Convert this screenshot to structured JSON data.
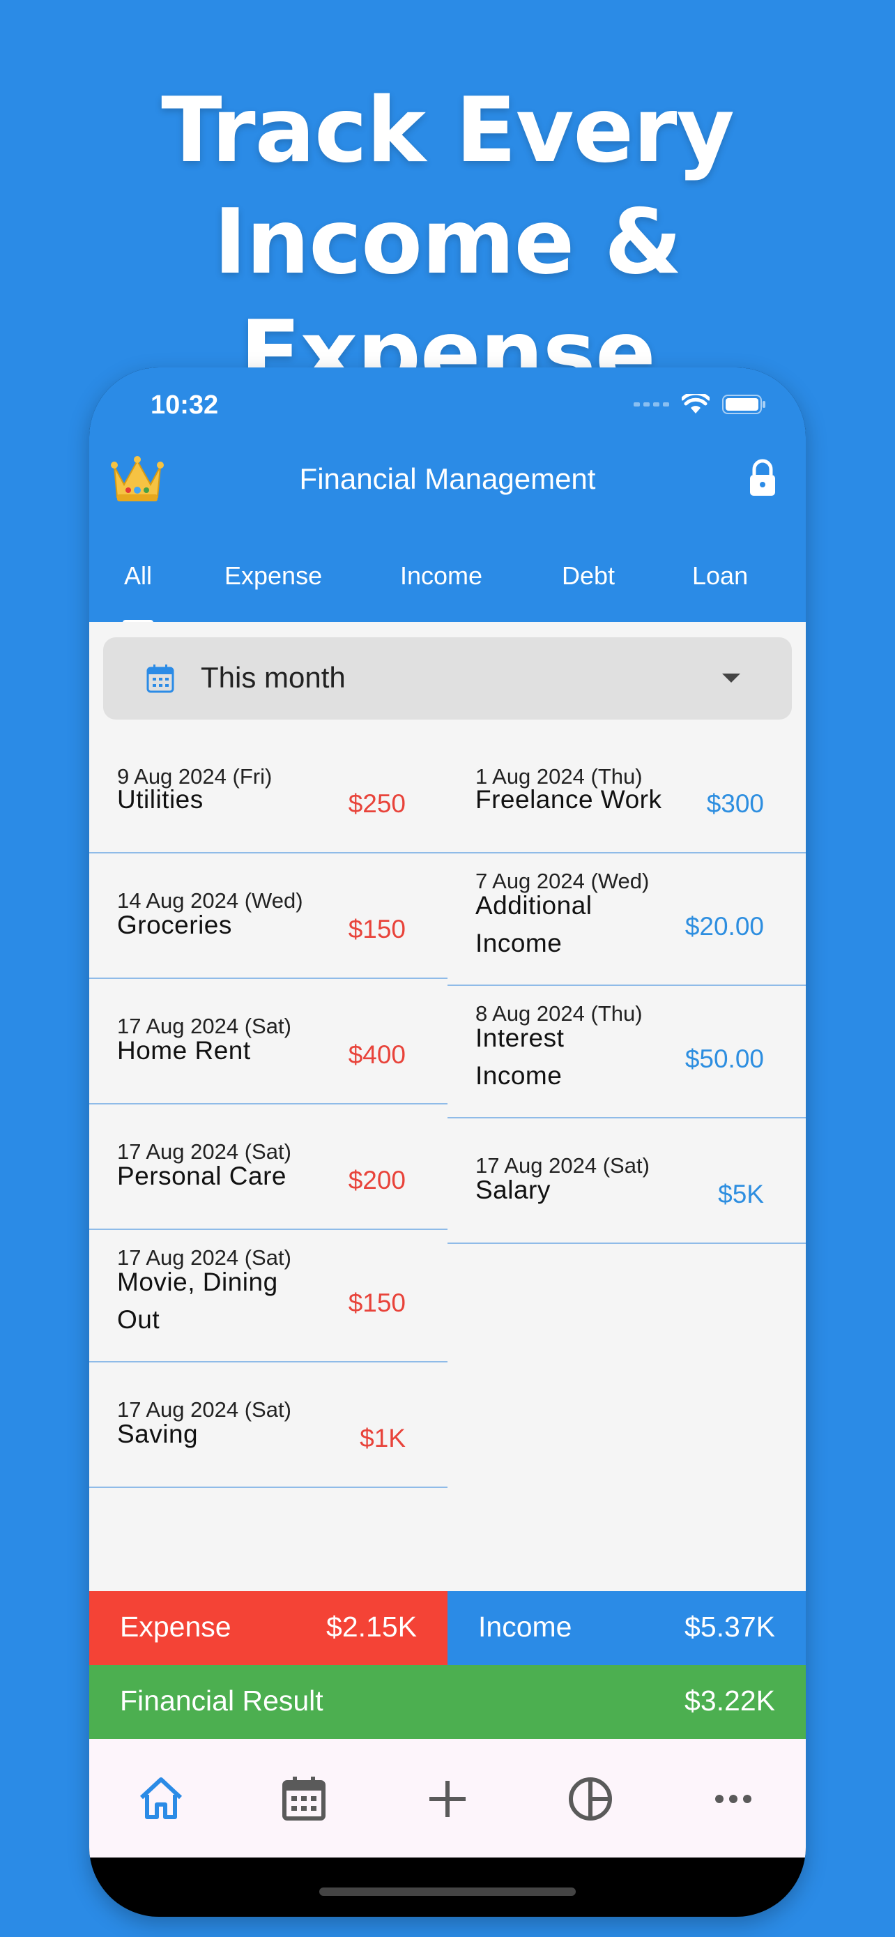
{
  "headline": {
    "line1": "Track Every",
    "line2": "Income & Expense"
  },
  "status_bar": {
    "time": "10:32"
  },
  "header": {
    "title": "Financial Management"
  },
  "tabs": [
    {
      "label": "All",
      "active": true
    },
    {
      "label": "Expense"
    },
    {
      "label": "Income"
    },
    {
      "label": "Debt"
    },
    {
      "label": "Loan"
    }
  ],
  "period_selector": {
    "label": "This month"
  },
  "expenses": [
    {
      "date": "9 Aug 2024 (Fri)",
      "name": "Utilities",
      "amount": "$250"
    },
    {
      "date": "14 Aug 2024 (Wed)",
      "name": "Groceries",
      "amount": "$150"
    },
    {
      "date": "17 Aug 2024 (Sat)",
      "name": "Home Rent",
      "amount": "$400"
    },
    {
      "date": "17 Aug 2024 (Sat)",
      "name": "Personal Care",
      "amount": "$200"
    },
    {
      "date": "17 Aug 2024 (Sat)",
      "name_line1": "Movie, Dining",
      "name_line2": "Out",
      "amount": "$150"
    },
    {
      "date": "17 Aug 2024 (Sat)",
      "name": "Saving",
      "amount": "$1K"
    }
  ],
  "incomes": [
    {
      "date": "1 Aug 2024 (Thu)",
      "name": "Freelance Work",
      "amount": "$300"
    },
    {
      "date": "7 Aug 2024 (Wed)",
      "name_line1": "Additional",
      "name_line2": "Income",
      "amount": "$20.00"
    },
    {
      "date": "8 Aug 2024 (Thu)",
      "name_line1": "Interest",
      "name_line2": "Income",
      "amount": "$50.00"
    },
    {
      "date": "17 Aug 2024 (Sat)",
      "name": "Salary",
      "amount": "$5K"
    }
  ],
  "summary": {
    "expense_label": "Expense",
    "expense_value": "$2.15K",
    "income_label": "Income",
    "income_value": "$5.37K",
    "result_label": "Financial Result",
    "result_value": "$3.22K"
  },
  "colors": {
    "primary": "#2b8be6",
    "expense": "#f44336",
    "income": "#2b8be6",
    "result": "#4caf50"
  },
  "icons": {
    "header_left": "crown-icon",
    "header_right": "lock-icon",
    "period": "calendar-icon",
    "fab": "plus-icon",
    "nav": [
      "home-icon",
      "calendar-icon",
      "plus-icon",
      "pie-chart-icon",
      "more-icon"
    ]
  }
}
